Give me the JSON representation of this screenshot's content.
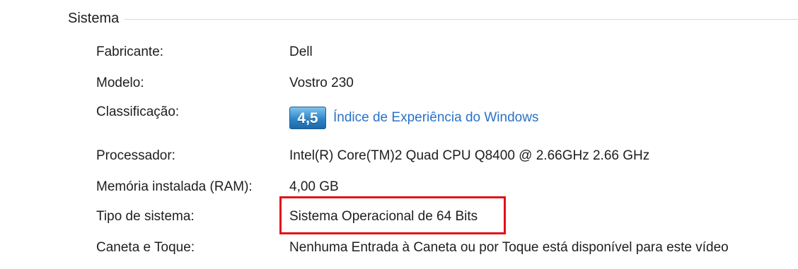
{
  "section": {
    "title": "Sistema"
  },
  "rows": [
    {
      "label": "Fabricante:",
      "value": "Dell"
    },
    {
      "label": "Modelo:",
      "value": "Vostro 230"
    },
    {
      "label": "Classificação:",
      "score": "4,5",
      "link": "Índice de Experiência do Windows"
    },
    {
      "label": "Processador:",
      "value": "Intel(R) Core(TM)2 Quad CPU   Q8400  @ 2.66GHz   2.66 GHz"
    },
    {
      "label": "Memória instalada (RAM):",
      "value": "4,00 GB"
    },
    {
      "label": "Tipo de sistema:",
      "value": "Sistema Operacional de 64 Bits"
    },
    {
      "label": "Caneta e Toque:",
      "value": "Nenhuma Entrada à Caneta ou por Toque está disponível para este vídeo"
    }
  ],
  "colors": {
    "link": "#2a72c6",
    "highlight": "#e0121b",
    "badge": "#2e86c8"
  }
}
